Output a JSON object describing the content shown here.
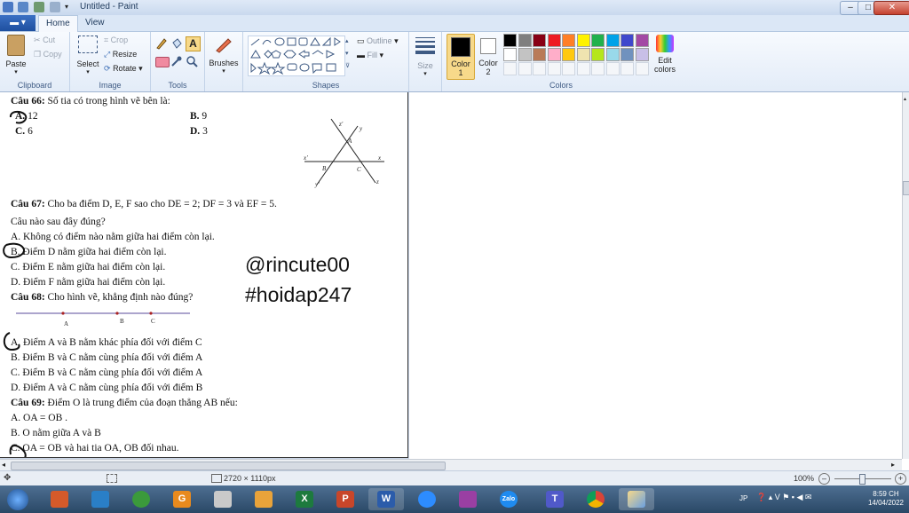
{
  "window": {
    "title": "Untitled - Paint"
  },
  "tabs": {
    "home": "Home",
    "view": "View"
  },
  "ribbon": {
    "clipboard": {
      "label": "Clipboard",
      "paste": "Paste",
      "cut": "Cut",
      "copy": "Copy"
    },
    "image": {
      "label": "Image",
      "select": "Select",
      "crop": "Crop",
      "resize": "Resize",
      "rotate": "Rotate"
    },
    "tools": {
      "label": "Tools"
    },
    "brushes": {
      "label": "Brushes"
    },
    "shapes": {
      "label": "Shapes",
      "outline": "Outline",
      "fill": "Fill"
    },
    "size": {
      "label": "Size"
    },
    "colors": {
      "label": "Colors",
      "color1": "Color",
      "color1_num": "1",
      "color2": "Color",
      "color2_num": "2",
      "edit1": "Edit",
      "edit2": "colors",
      "palette_row1": [
        "#000000",
        "#7f7f7f",
        "#880015",
        "#ed1c24",
        "#ff7f27",
        "#fff200",
        "#22b14c",
        "#00a2e8",
        "#3f48cc",
        "#a349a4"
      ],
      "palette_row2": [
        "#ffffff",
        "#c3c3c3",
        "#b97a57",
        "#ffaec9",
        "#ffc90e",
        "#efe4b0",
        "#b5e61d",
        "#99d9ea",
        "#7092be",
        "#c8bfe7"
      ],
      "color1_value": "#000000",
      "color2_value": "#ffffff"
    }
  },
  "document": {
    "q66": {
      "title": "Câu 66:",
      "text": "Số tia có trong hình vẽ bên là:",
      "a_label": "A.",
      "a": "12",
      "b_label": "B.",
      "b": "9",
      "c_label": "C.",
      "c": "6",
      "d_label": "D.",
      "d": "3"
    },
    "figure_labels": {
      "z1": "z'",
      "y": "y",
      "a": "A",
      "x1": "x'",
      "b": "B",
      "c": "C",
      "x": "x",
      "y1": "y'",
      "z": "z"
    },
    "q67": {
      "title": "Câu 67:",
      "text": "Cho ba điểm  D, E, F  sao cho  DE = 2; DF = 3  và  EF = 5.",
      "question": "Câu nào sau đây đúng?",
      "a": "A. Không có điểm nào nằm giữa hai điểm còn lại.",
      "b": "B. Điểm  D  nằm giữa hai điểm còn lại.",
      "c": "C. Điểm  E  nằm giữa hai điểm còn lại.",
      "d": "D. Điểm  F  nằm giữa hai điểm còn lại."
    },
    "q68": {
      "title": "Câu 68:",
      "text": "Cho hình vẽ, khẳng định nào đúng?",
      "points": [
        "A",
        "B",
        "C"
      ],
      "a": "A. Điểm A và B nằm khác phía đối với điểm C",
      "b": "B. Điểm B và C nằm cùng phía đối với điểm A",
      "c": "C. Điểm B và C nằm cùng phía đối với điểm A",
      "d": "D. Điểm A và C nằm cùng phía đối với điểm B"
    },
    "q69": {
      "title": "Câu 69:",
      "text": "Điểm  O  là trung điểm của đoạn thẳng  AB nếu:",
      "a": "A.  OA = OB .",
      "b": "B. O nằm giữa A và B",
      "c": "C.  OA = OB  và hai tia  OA, OB  đối nhau."
    },
    "watermark1": "@rincute00",
    "watermark2": "#hoidap247"
  },
  "status": {
    "dimensions": "2720 × 1110px",
    "zoom": "100%"
  },
  "taskbar": {
    "lang": "JP",
    "time": "8:59 CH",
    "date": "14/04/2022"
  }
}
